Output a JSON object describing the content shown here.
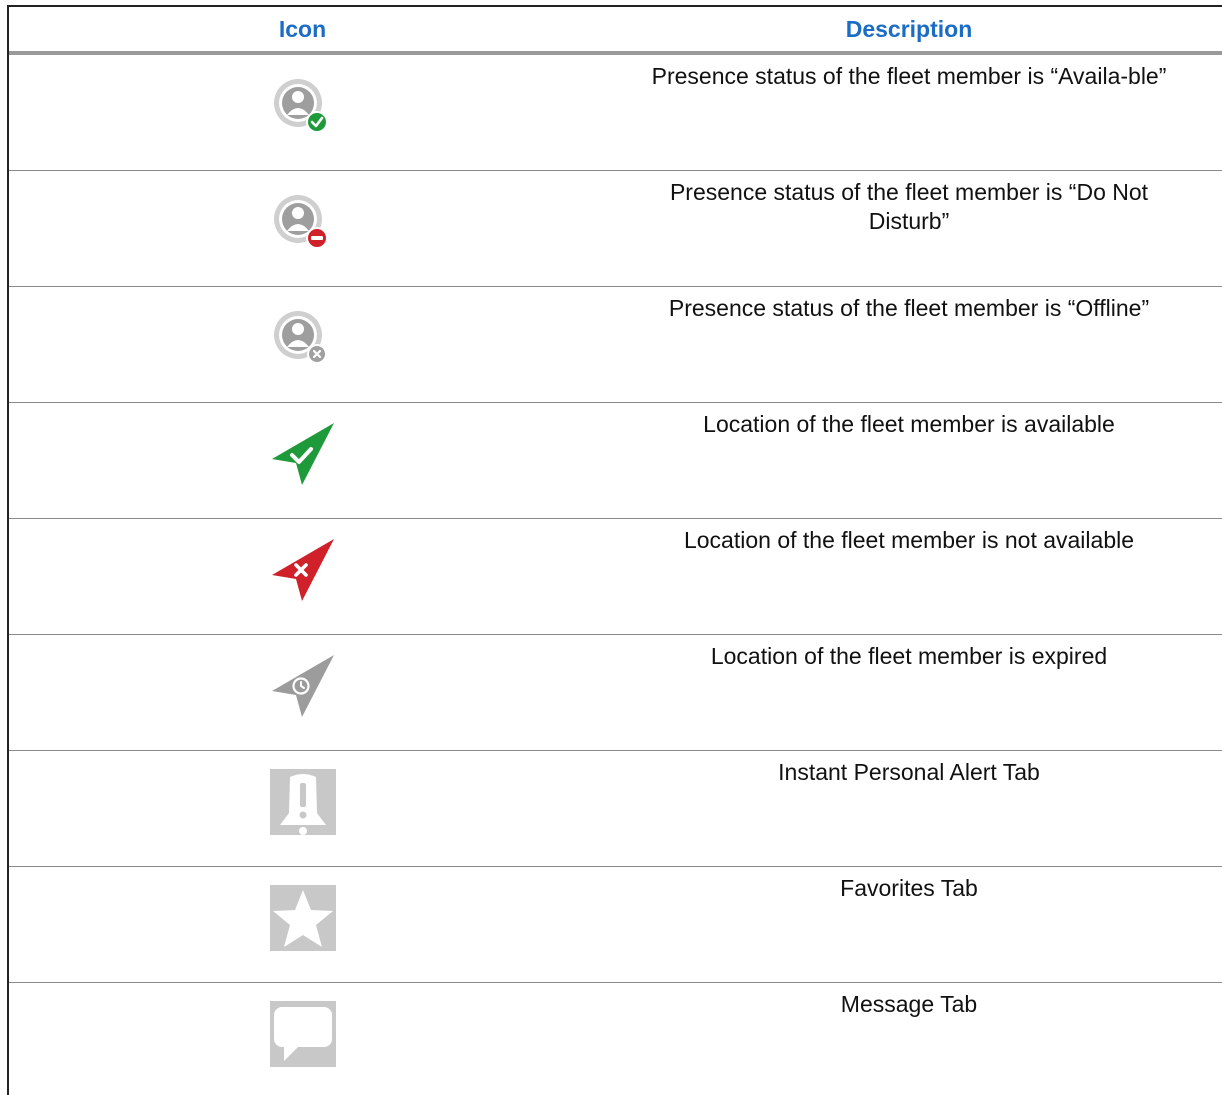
{
  "table": {
    "headers": {
      "icon": "Icon",
      "description": "Description"
    },
    "rows": [
      {
        "icon": "presence-available-icon",
        "description": "Presence status of the fleet member is “Availa-ble”"
      },
      {
        "icon": "presence-do-not-disturb-icon",
        "description": "Presence status of the fleet member is “Do Not Disturb”"
      },
      {
        "icon": "presence-offline-icon",
        "description": "Presence status of the fleet member is “Offline”"
      },
      {
        "icon": "location-available-icon",
        "description": "Location of the fleet member is available"
      },
      {
        "icon": "location-not-available-icon",
        "description": "Location of the fleet member is not available"
      },
      {
        "icon": "location-expired-icon",
        "description": "Location of the fleet member is expired"
      },
      {
        "icon": "instant-personal-alert-tab-icon",
        "description": "Instant Personal Alert Tab"
      },
      {
        "icon": "favorites-tab-icon",
        "description": "Favorites Tab"
      },
      {
        "icon": "message-tab-icon",
        "description": "Message Tab"
      }
    ]
  },
  "colors": {
    "header_text": "#1a6cc5",
    "green": "#1f9a3a",
    "red": "#d0202a",
    "gray": "#9c9c9c",
    "light_gray": "#c8c8c8"
  }
}
